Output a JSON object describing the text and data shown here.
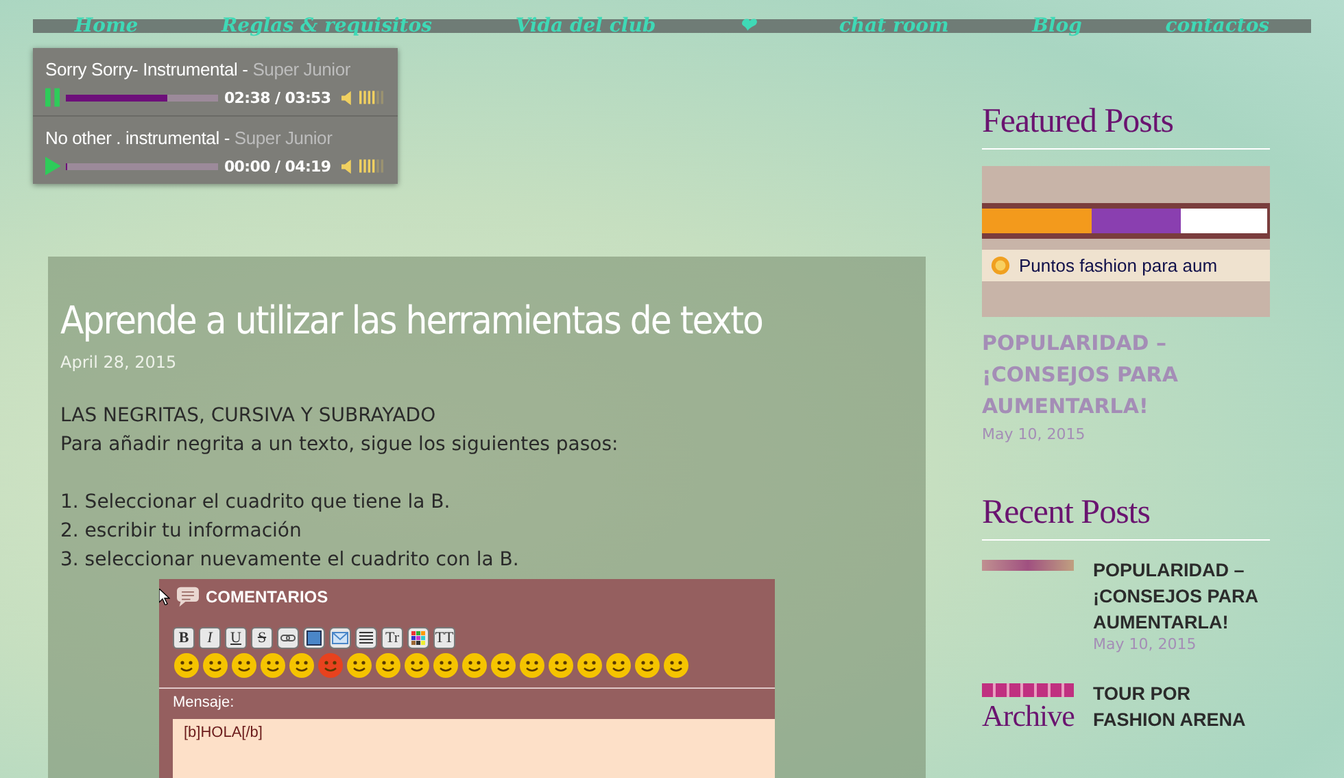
{
  "nav": {
    "items": [
      {
        "label": "Home"
      },
      {
        "label": "Reglas & requisitos"
      },
      {
        "label": "Vida del club"
      },
      {
        "label": "❤"
      },
      {
        "label": "chat room"
      },
      {
        "label": "Blog"
      },
      {
        "label": "contactos"
      }
    ]
  },
  "player": {
    "tracks": [
      {
        "title": "Sorry Sorry- Instrumental",
        "separator": "-",
        "artist": "Super Junior",
        "playing": true,
        "level": 0.66,
        "time": "02:38 / 03:53",
        "volume": {
          "level": 0.67
        }
      },
      {
        "title": "No other . instrumental",
        "separator": "-",
        "artist": "Super Junior",
        "playing": false,
        "level": 0.0,
        "time": "00:00 / 04:19",
        "volume": {
          "level": 0.67
        }
      }
    ]
  },
  "post": {
    "title": "Aprende a utilizar las herramientas de texto",
    "date": "April 28, 2015",
    "paragraphs": [
      [
        " LAS NEGRITAS, CURSIVA Y SUBRAYADO",
        "Para añadir negrita a un texto, sigue los siguientes pasos:"
      ],
      [
        "1. Seleccionar el cuadrito que tiene la B.",
        "2. escribir tu información",
        "3. seleccionar nuevamente el cuadrito con la B."
      ]
    ],
    "comments_box": {
      "heading": "COMENTARIOS",
      "toolbar": [
        {
          "kind": "text",
          "label": "B"
        },
        {
          "kind": "text",
          "label": "I"
        },
        {
          "kind": "text",
          "label": "U"
        },
        {
          "kind": "text",
          "label": "S"
        },
        {
          "kind": "link"
        },
        {
          "kind": "image"
        },
        {
          "kind": "mail"
        },
        {
          "kind": "align"
        },
        {
          "kind": "text",
          "label": "Tr"
        },
        {
          "kind": "colors"
        },
        {
          "kind": "text",
          "label": "TT"
        }
      ],
      "message_label": "Mensaje:",
      "message_value": "[b]HOLA[/b]"
    }
  },
  "sidebar": {
    "featured": {
      "heading": "Featured Posts",
      "image_text": "Puntos fashion para aum",
      "title": "POPULARIDAD – ¡CONSEJOS PARA AUMENTARLA!",
      "date": "May 10, 2015"
    },
    "recent": {
      "heading": "Recent Posts",
      "items": [
        {
          "title": "POPULARIDAD – ¡CONSEJOS PARA AUMENTARLA!",
          "date": "May 10, 2015"
        },
        {
          "title": "TOUR POR FASHION ARENA"
        }
      ]
    },
    "archive": {
      "heading": "Archive"
    }
  }
}
